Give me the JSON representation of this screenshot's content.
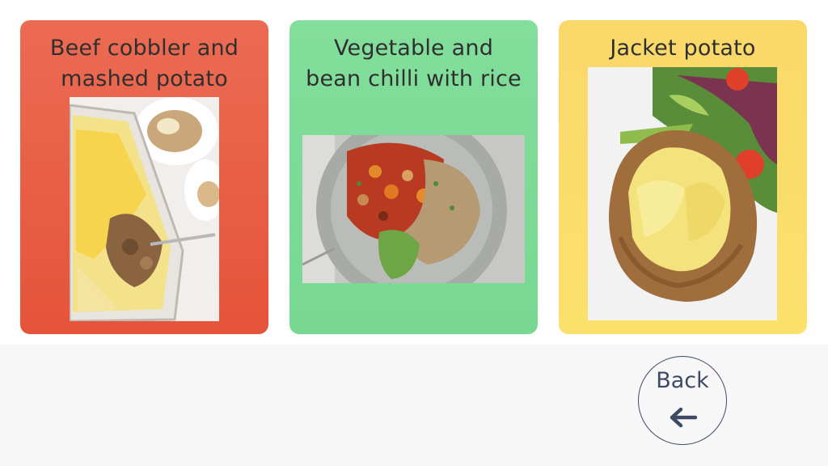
{
  "colors": {
    "card1": "#e65a3e",
    "card2": "#7ddc97",
    "card3": "#fadb6b",
    "back_text": "#3d4a66"
  },
  "cards": [
    {
      "title": "Beef cobbler and\nmashed potato",
      "image": "beef-cobbler-photo"
    },
    {
      "title": "Vegetable and\nbean chilli with rice",
      "image": "vegetable-chilli-photo"
    },
    {
      "title": "Jacket potato",
      "image": "jacket-potato-photo"
    }
  ],
  "back": {
    "label": "Back",
    "icon": "arrow-left-icon"
  }
}
